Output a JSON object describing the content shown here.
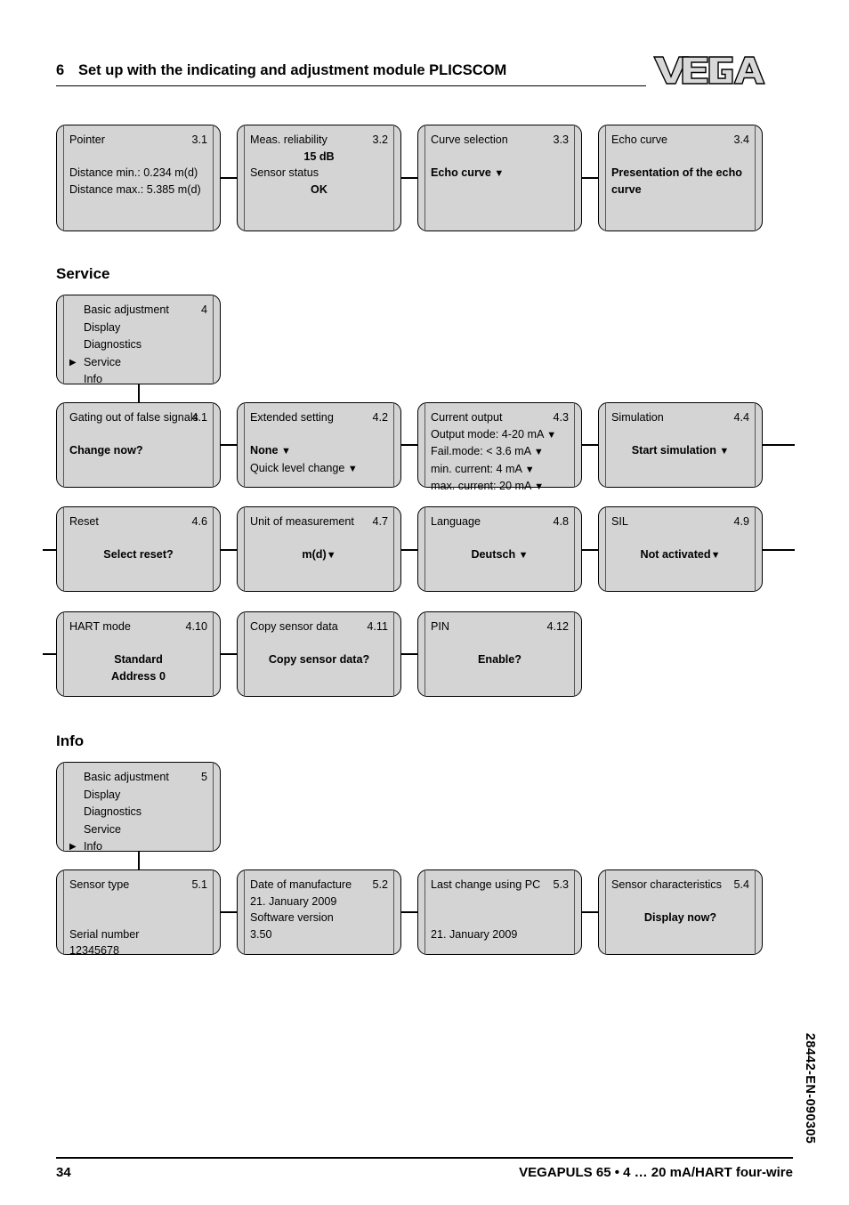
{
  "header": {
    "chapter_number": "6",
    "title": "Set up with the indicating and adjustment module PLICSCOM",
    "logo_text": "VEGA"
  },
  "sections": [
    {
      "id": "diagnostics-row",
      "title": ""
    },
    {
      "id": "service",
      "title": "Service"
    },
    {
      "id": "info",
      "title": "Info"
    }
  ],
  "section_titles": {
    "service": "Service",
    "info": "Info"
  },
  "diagnostics_row": [
    {
      "num": "3.1",
      "title": "Pointer",
      "lines": [
        {
          "text": "",
          "bold": false,
          "center": false
        },
        {
          "text": "Distance min.: 0.234 m(d)",
          "bold": false,
          "center": false
        },
        {
          "text": "Distance max.: 5.385 m(d)",
          "bold": false,
          "center": false
        }
      ]
    },
    {
      "num": "3.2",
      "title": "Meas. reliability",
      "lines": [
        {
          "text": "15 dB",
          "bold": true,
          "center": true
        },
        {
          "text": "Sensor status",
          "bold": false,
          "center": false
        },
        {
          "text": "OK",
          "bold": true,
          "center": true
        }
      ]
    },
    {
      "num": "3.3",
      "title": "Curve selection",
      "lines": [
        {
          "text": "",
          "bold": false,
          "center": false
        },
        {
          "text": "Echo curve ▼",
          "bold": true,
          "center": false
        }
      ]
    },
    {
      "num": "3.4",
      "title": "Echo curve",
      "lines": [
        {
          "text": "",
          "bold": false,
          "center": false
        },
        {
          "text": "Presentation of the echo",
          "bold": true,
          "center": false
        },
        {
          "text": "curve",
          "bold": true,
          "center": false
        }
      ]
    }
  ],
  "service_menu": {
    "num": "4",
    "items": [
      {
        "label": "Basic adjustment",
        "selected": false
      },
      {
        "label": "Display",
        "selected": false
      },
      {
        "label": "Diagnostics",
        "selected": false
      },
      {
        "label": "Service",
        "selected": true
      },
      {
        "label": "Info",
        "selected": false
      }
    ],
    "marker": "▶"
  },
  "service_row1": [
    {
      "num": "4.1",
      "title": "Gating out of false signals",
      "lines": [
        {
          "text": "",
          "bold": false,
          "center": false
        },
        {
          "text": "Change now?",
          "bold": true,
          "center": false
        }
      ]
    },
    {
      "num": "4.2",
      "title": "Extended setting",
      "lines": [
        {
          "text": "",
          "bold": false,
          "center": false
        },
        {
          "text": "None ▼",
          "bold": true,
          "center": false
        },
        {
          "text": "Quick level change ▼",
          "bold": false,
          "center": false
        }
      ]
    },
    {
      "num": "4.3",
      "title": "Current output",
      "lines": [
        {
          "text": "Output mode: 4-20 mA ▼",
          "bold": false,
          "center": false
        },
        {
          "text": "Fail.mode: < 3.6 mA ▼",
          "bold": false,
          "center": false
        },
        {
          "text": "min. current: 4 mA ▼",
          "bold": false,
          "center": false
        },
        {
          "text": "max. current: 20 mA ▼",
          "bold": false,
          "center": false
        }
      ]
    },
    {
      "num": "4.4",
      "title": "Simulation",
      "lines": [
        {
          "text": "",
          "bold": false,
          "center": false
        },
        {
          "text": "Start simulation ▼",
          "bold": true,
          "center": true
        }
      ]
    }
  ],
  "service_row2": [
    {
      "num": "4.6",
      "title": "Reset",
      "lines": [
        {
          "text": "",
          "bold": false,
          "center": false
        },
        {
          "text": "Select reset?",
          "bold": true,
          "center": true
        }
      ]
    },
    {
      "num": "4.7",
      "title": "Unit of measurement",
      "lines": [
        {
          "text": "",
          "bold": false,
          "center": false
        },
        {
          "text": "m(d)▼",
          "bold": true,
          "center": true
        }
      ]
    },
    {
      "num": "4.8",
      "title": "Language",
      "lines": [
        {
          "text": "",
          "bold": false,
          "center": false
        },
        {
          "text": "Deutsch ▼",
          "bold": true,
          "center": true
        }
      ]
    },
    {
      "num": "4.9",
      "title": "SIL",
      "lines": [
        {
          "text": "",
          "bold": false,
          "center": false
        },
        {
          "text": "Not activated▼",
          "bold": true,
          "center": true
        }
      ]
    }
  ],
  "service_row3": [
    {
      "num": "4.10",
      "title": "HART mode",
      "lines": [
        {
          "text": "",
          "bold": false,
          "center": false
        },
        {
          "text": "Standard",
          "bold": true,
          "center": true
        },
        {
          "text": "Address 0",
          "bold": true,
          "center": true
        }
      ]
    },
    {
      "num": "4.11",
      "title": "Copy sensor data",
      "lines": [
        {
          "text": "",
          "bold": false,
          "center": false
        },
        {
          "text": "Copy sensor data?",
          "bold": true,
          "center": true
        }
      ]
    },
    {
      "num": "4.12",
      "title": "PIN",
      "lines": [
        {
          "text": "",
          "bold": false,
          "center": false
        },
        {
          "text": "Enable?",
          "bold": true,
          "center": true
        }
      ]
    }
  ],
  "info_menu": {
    "num": "5",
    "items": [
      {
        "label": "Basic adjustment",
        "selected": false
      },
      {
        "label": "Display",
        "selected": false
      },
      {
        "label": "Diagnostics",
        "selected": false
      },
      {
        "label": "Service",
        "selected": false
      },
      {
        "label": "Info",
        "selected": true
      }
    ],
    "marker": "▶"
  },
  "info_row": [
    {
      "num": "5.1",
      "title": "Sensor type",
      "lines": [
        {
          "text": "",
          "bold": false,
          "center": false
        },
        {
          "text": "",
          "bold": false,
          "center": false
        },
        {
          "text": "Serial number",
          "bold": false,
          "center": false
        },
        {
          "text": "12345678",
          "bold": false,
          "center": false
        }
      ]
    },
    {
      "num": "5.2",
      "title": "Date of manufacture",
      "lines": [
        {
          "text": "21. January 2009",
          "bold": false,
          "center": false
        },
        {
          "text": "Software version",
          "bold": false,
          "center": false
        },
        {
          "text": "3.50",
          "bold": false,
          "center": false
        }
      ]
    },
    {
      "num": "5.3",
      "title": "Last change using PC",
      "lines": [
        {
          "text": "",
          "bold": false,
          "center": false
        },
        {
          "text": "",
          "bold": false,
          "center": false
        },
        {
          "text": "21. January 2009",
          "bold": false,
          "center": false
        }
      ]
    },
    {
      "num": "5.4",
      "title": "Sensor characteristics",
      "lines": [
        {
          "text": "",
          "bold": false,
          "center": false
        },
        {
          "text": "Display now?",
          "bold": true,
          "center": true
        }
      ]
    }
  ],
  "footer": {
    "page_number": "34",
    "product": "VEGAPULS 65 • 4 … 20 mA/HART four-wire",
    "doc_code": "28442-EN-090305"
  }
}
